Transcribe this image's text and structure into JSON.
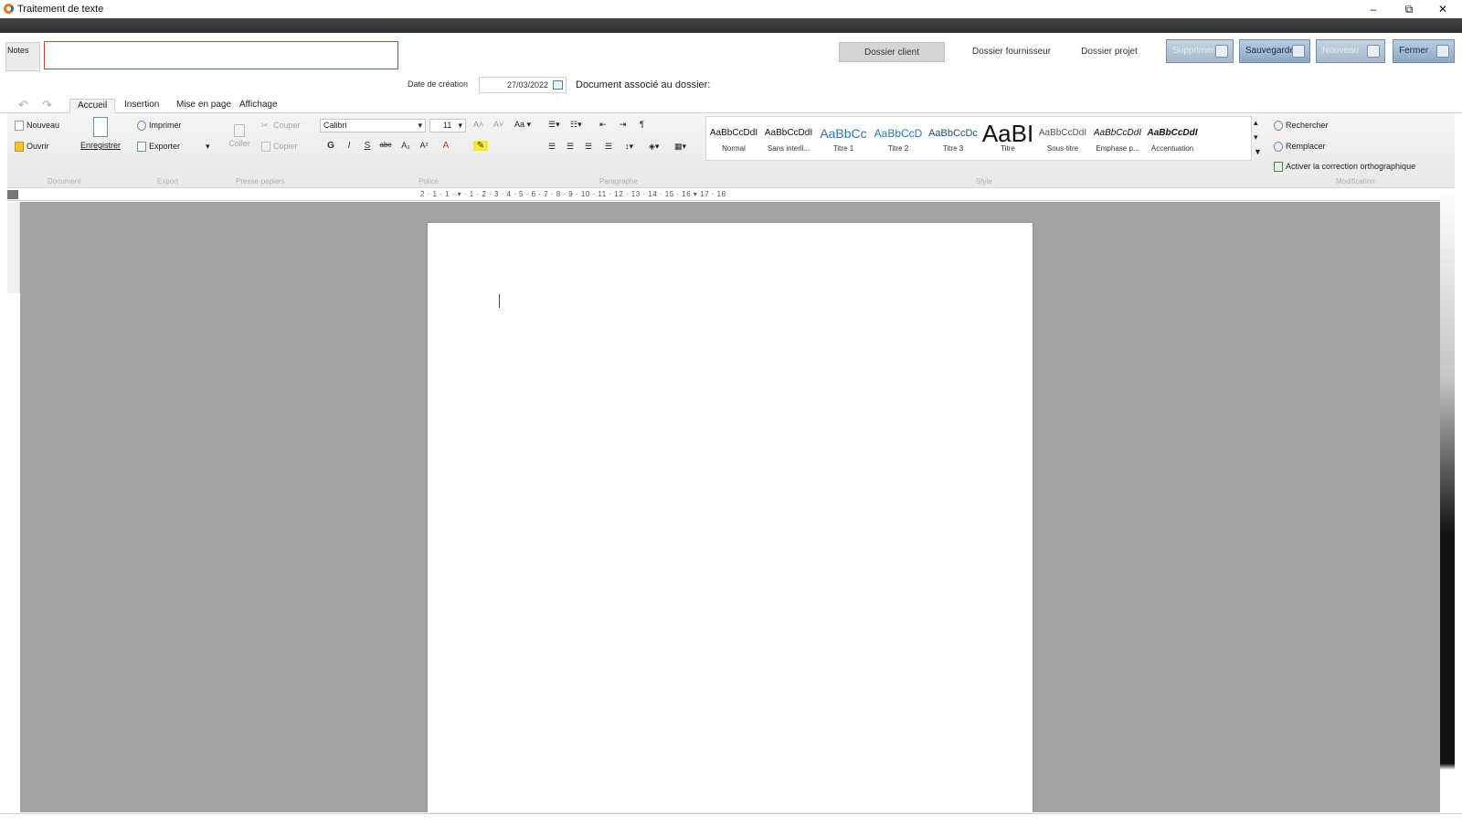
{
  "window": {
    "title": "Traitement de texte",
    "minimize": "–",
    "restore": "⧉",
    "close": "✕"
  },
  "header": {
    "notes_label": "Notes",
    "notes_value": "",
    "folder_tabs": [
      "Dossier client",
      "Dossier fournisseur",
      "Dossier projet"
    ],
    "actions": {
      "delete": "Supprimer",
      "save": "Sauvegarde",
      "new": "Nouveau",
      "close": "Fermer"
    },
    "date_label": "Date de création",
    "date_value": "27/03/2022",
    "associated_label": "Document associé au dossier:"
  },
  "ribbon": {
    "tabs": [
      "Accueil",
      "Insertion",
      "Mise en page",
      "Affichage"
    ],
    "active_tab": "Accueil",
    "document": {
      "new": "Nouveau",
      "open": "Ouvrir",
      "save": "Enregistrer"
    },
    "export": {
      "print": "Imprimer",
      "export": "Exporter"
    },
    "clipboard": {
      "paste": "Coller",
      "cut": "Couper",
      "copy": "Copier"
    },
    "font": {
      "family": "Calibri",
      "size": "11"
    },
    "styles": [
      {
        "sample": "AaBbCcDdI",
        "name": "Normal"
      },
      {
        "sample": "AaBbCcDdI",
        "name": "Sans interli..."
      },
      {
        "sample": "AaBbCc",
        "name": "Titre 1"
      },
      {
        "sample": "AaBbCcD",
        "name": "Titre 2"
      },
      {
        "sample": "AaBbCcDc",
        "name": "Titre 3"
      },
      {
        "sample": "AaBI",
        "name": "Titre"
      },
      {
        "sample": "AaBbCcDdI",
        "name": "Sous-titre"
      },
      {
        "sample": "AaBbCcDdI",
        "name": "Emphase p..."
      },
      {
        "sample": "AaBbCcDdI",
        "name": "Accentuation"
      }
    ],
    "modification": {
      "search": "Rechercher",
      "replace": "Remplacer",
      "spellcheck": "Activer la correction orthographique"
    },
    "groups": [
      "Document",
      "Export",
      "Presse-papiers",
      "Police",
      "Paragraphe",
      "Style",
      "Modification"
    ]
  },
  "ruler": {
    "scale": "2 · 1 · 1 · ▾ · 1 · 2 · 3 · 4 · 5 · 6 · 7 · 8 · 9 · 10 · 11 · 12 · 13 · 14 · 15 · 16 ▾ 17 · 18"
  },
  "colors": {
    "accent_button": "#8fa9c4",
    "canvas": "#a3a3a3",
    "notes_border": "#b94a4a"
  }
}
